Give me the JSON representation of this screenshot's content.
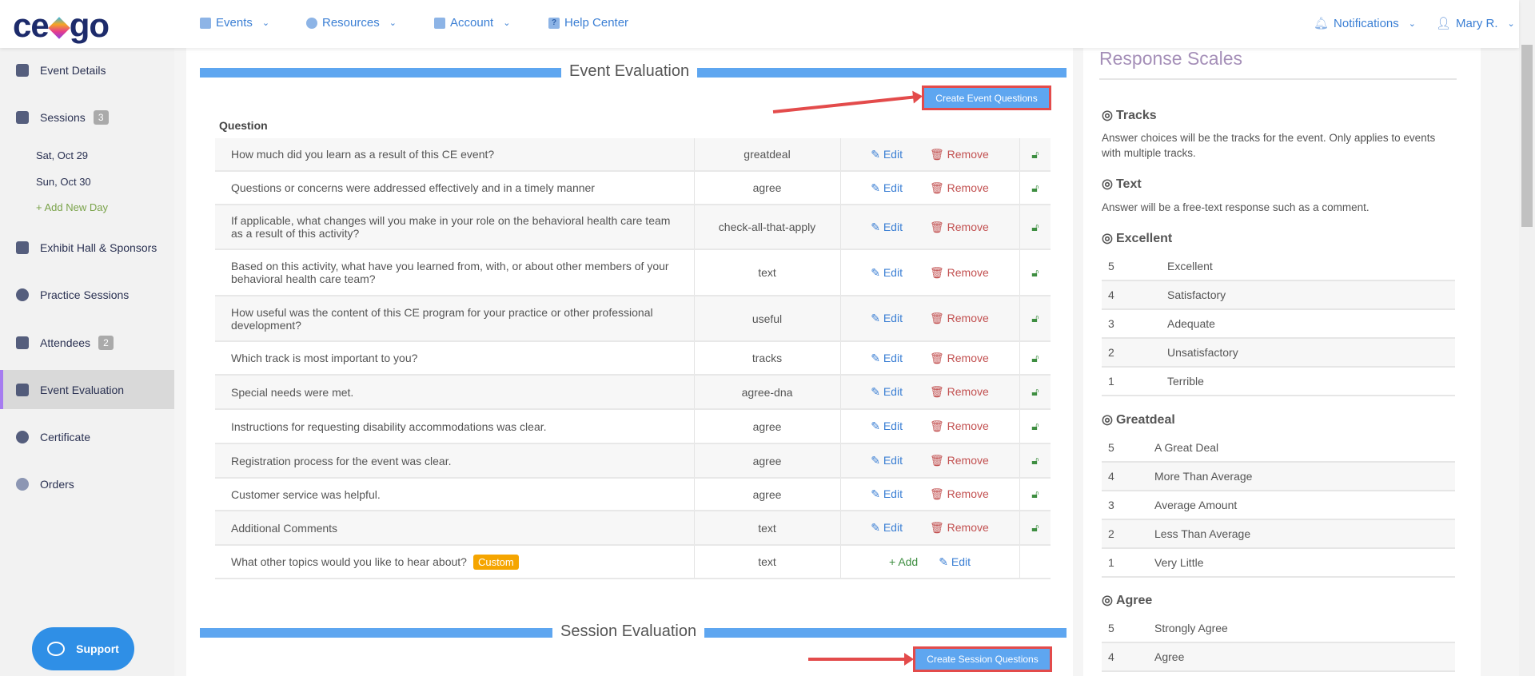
{
  "header": {
    "logo": "ce go",
    "nav": [
      {
        "label": "Events"
      },
      {
        "label": "Resources"
      },
      {
        "label": "Account"
      },
      {
        "label": "Help Center"
      }
    ],
    "notifications": "Notifications",
    "user": "Mary R."
  },
  "sidebar": {
    "items": [
      {
        "label": "Event Details"
      },
      {
        "label": "Sessions",
        "badge": "3"
      },
      {
        "label": "Exhibit Hall & Sponsors"
      },
      {
        "label": "Practice Sessions"
      },
      {
        "label": "Attendees",
        "badge": "2"
      },
      {
        "label": "Event Evaluation"
      },
      {
        "label": "Certificate"
      },
      {
        "label": "Orders"
      }
    ],
    "days": [
      "Sat, Oct 29",
      "Sun, Oct 30"
    ],
    "add_day": "+  Add New Day",
    "support": "Support"
  },
  "event_eval": {
    "title": "Event Evaluation",
    "create_button": "Create Event Questions",
    "column_header": "Question",
    "rows": [
      {
        "q": "How much did you learn as a result of this CE event?",
        "scale": "greatdeal"
      },
      {
        "q": "Questions or concerns were addressed effectively and in a timely manner",
        "scale": "agree"
      },
      {
        "q": "If applicable, what changes will you make in your role on the behavioral health care team as a result of this activity?",
        "scale": "check-all-that-apply"
      },
      {
        "q": "Based on this activity, what have you learned from, with, or about other members of your behavioral health care team?",
        "scale": "text"
      },
      {
        "q": "How useful was the content of this CE program for your practice or other professional development?",
        "scale": "useful"
      },
      {
        "q": "Which track is most important to you?",
        "scale": "tracks"
      },
      {
        "q": "Special needs were met.",
        "scale": "agree-dna"
      },
      {
        "q": "Instructions for requesting disability accommodations was clear.",
        "scale": "agree"
      },
      {
        "q": "Registration process for the event was clear.",
        "scale": "agree"
      },
      {
        "q": "Customer service was helpful.",
        "scale": "agree"
      },
      {
        "q": "Additional Comments",
        "scale": "text"
      },
      {
        "q": "What other topics would you like to hear about?",
        "scale": "text",
        "custom": "Custom"
      }
    ],
    "edit": "Edit",
    "remove": "Remove",
    "add": "Add"
  },
  "session_eval": {
    "title": "Session Evaluation",
    "create_button": "Create Session Questions"
  },
  "response_scales": {
    "title": "Response Scales",
    "tracks": {
      "name": "Tracks",
      "desc": "Answer choices will be the tracks for the event. Only applies to events with multiple tracks."
    },
    "text": {
      "name": "Text",
      "desc": "Answer will be a free-text response such as a comment."
    },
    "excellent": {
      "name": "Excellent",
      "rows": [
        [
          "5",
          "Excellent"
        ],
        [
          "4",
          "Satisfactory"
        ],
        [
          "3",
          "Adequate"
        ],
        [
          "2",
          "Unsatisfactory"
        ],
        [
          "1",
          "Terrible"
        ]
      ]
    },
    "greatdeal": {
      "name": "Greatdeal",
      "rows": [
        [
          "5",
          "A Great Deal"
        ],
        [
          "4",
          "More Than Average"
        ],
        [
          "3",
          "Average Amount"
        ],
        [
          "2",
          "Less Than Average"
        ],
        [
          "1",
          "Very Little"
        ]
      ]
    },
    "agree": {
      "name": "Agree",
      "rows": [
        [
          "5",
          "Strongly Agree"
        ],
        [
          "4",
          "Agree"
        ]
      ]
    }
  }
}
